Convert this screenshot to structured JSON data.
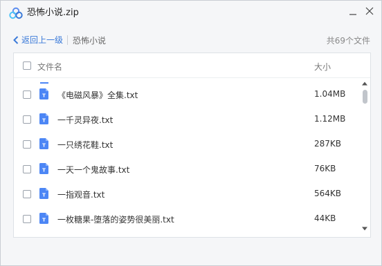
{
  "window": {
    "title": "恐怖小说.zip",
    "colors": {
      "accent": "#3b7ad9",
      "file_icon": "#4c86f5",
      "brand": "#5b8def"
    }
  },
  "breadcrumb": {
    "back_label": "返回上一级",
    "current": "恐怖小说",
    "file_count": "共69个文件"
  },
  "table": {
    "columns": {
      "name": "文件名",
      "size": "大小"
    },
    "rows": [
      {
        "icon_label": "T",
        "name": "《电磁风暴》全集.txt",
        "size": "1.04MB"
      },
      {
        "icon_label": "T",
        "name": "一千灵异夜.txt",
        "size": "1.12MB"
      },
      {
        "icon_label": "T",
        "name": "一只绣花鞋.txt",
        "size": "287KB"
      },
      {
        "icon_label": "T",
        "name": "一天一个鬼故事.txt",
        "size": "76KB"
      },
      {
        "icon_label": "T",
        "name": "一指观音.txt",
        "size": "564KB"
      },
      {
        "icon_label": "T",
        "name": "一枚糖果-堕落的姿势很美丽.txt",
        "size": "44KB"
      }
    ]
  }
}
